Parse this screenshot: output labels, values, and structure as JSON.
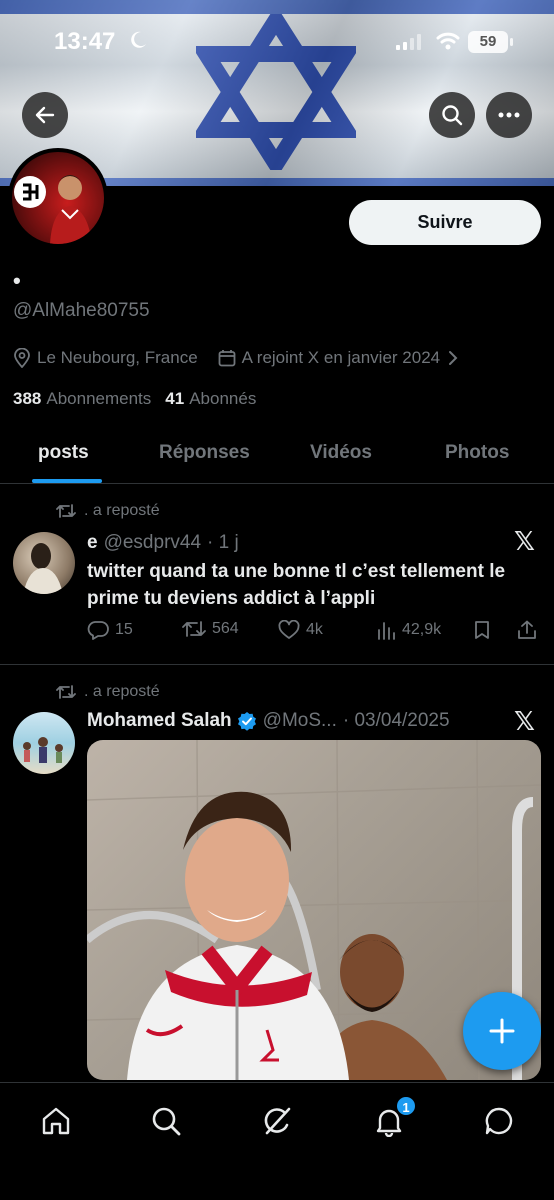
{
  "status_bar": {
    "time": "13:47",
    "battery": "59"
  },
  "profile": {
    "display_name": "•",
    "handle": "@AlMahe80755",
    "location": "Le Neubourg, France",
    "joined": "A rejoint X en janvier 2024",
    "following_count": "388",
    "following_label": "Abonnements",
    "followers_count": "41",
    "followers_label": "Abonnés",
    "follow_button": "Suivre"
  },
  "tabs": [
    "posts",
    "Réponses",
    "Vidéos",
    "Photos"
  ],
  "active_tab": "posts",
  "posts": [
    {
      "repost_label": ". a reposté",
      "author_name": "e",
      "author_handle": "@esdprv44",
      "time": "· 1 j",
      "text": "twitter quand ta une bonne tl c’est tellement le prime tu deviens addict à l’appli",
      "replies": "15",
      "reposts": "564",
      "likes": "4k",
      "views": "42,9k"
    },
    {
      "repost_label": ". a reposté",
      "author_name": "Mohamed Salah",
      "author_handle": "@MoS...",
      "time": "· 03/04/2025",
      "verified": true
    }
  ],
  "bottom_nav": {
    "notification_count": "1"
  },
  "icons": [
    "back-arrow-icon",
    "search-icon",
    "more-icon",
    "location-icon",
    "calendar-icon",
    "chevron-right-icon",
    "repost-icon",
    "x-logo-icon",
    "reply-icon",
    "like-icon",
    "views-icon",
    "bookmark-icon",
    "share-icon",
    "verified-icon",
    "compose-plus-icon",
    "home-icon",
    "explore-icon",
    "grok-icon",
    "bell-icon",
    "messages-icon",
    "moon-icon",
    "signal-icon",
    "wifi-icon"
  ],
  "colors": {
    "accent": "#1d9bf0",
    "background": "#000000",
    "muted": "#71767b",
    "flag_blue": "#2f4fb0"
  }
}
